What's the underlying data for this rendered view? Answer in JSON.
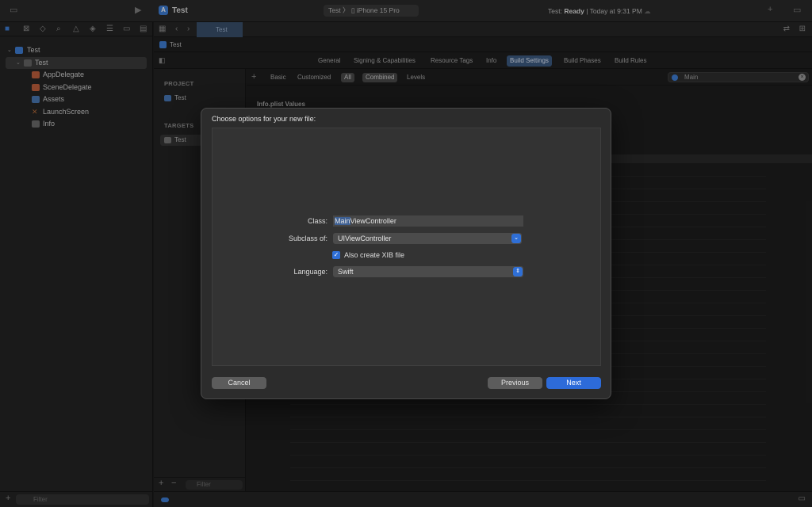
{
  "app": {
    "title": "Test",
    "scheme_target": "Test",
    "scheme_device": "iPhone 15 Pro",
    "status_prefix": "Test:",
    "status_state": "Ready",
    "status_time": "| Today at 9:31 PM"
  },
  "navigator": {
    "items": [
      {
        "label": "Test"
      },
      {
        "label": "Test"
      },
      {
        "label": "AppDelegate"
      },
      {
        "label": "SceneDelegate"
      },
      {
        "label": "Assets"
      },
      {
        "label": "LaunchScreen"
      },
      {
        "label": "Info"
      }
    ],
    "filter_placeholder": "Filter"
  },
  "editor": {
    "tab_label": "Test",
    "jump_label": "Test",
    "settings_tabs": [
      "General",
      "Signing & Capabilities",
      "Resource Tags",
      "Info",
      "Build Settings",
      "Build Phases",
      "Build Rules"
    ],
    "active_tab": "Build Settings",
    "project_header": "PROJECT",
    "project_item": "Test",
    "targets_header": "TARGETS",
    "target_item": "Test",
    "filter_placeholder": "Filter",
    "build_filters": [
      "Basic",
      "Customized",
      "All",
      "Combined",
      "Levels"
    ],
    "search_value": "Main",
    "section_title": "Info.plist Values"
  },
  "dialog": {
    "title": "Choose options for your new file:",
    "class_label": "Class:",
    "class_selected": "Main",
    "class_rest": "ViewController",
    "subclass_label": "Subclass of:",
    "subclass_value": "UIViewController",
    "xib_label": "Also create XIB file",
    "language_label": "Language:",
    "language_value": "Swift",
    "cancel_label": "Cancel",
    "previous_label": "Previous",
    "next_label": "Next"
  }
}
